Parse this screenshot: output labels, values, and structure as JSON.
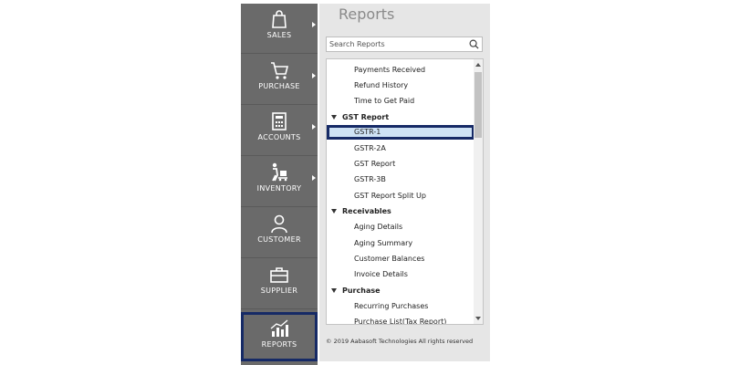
{
  "sidebar": {
    "items": [
      {
        "label": "SALES",
        "icon": "shopping-bag-icon",
        "has_arrow": true
      },
      {
        "label": "PURCHASE",
        "icon": "cart-icon",
        "has_arrow": true
      },
      {
        "label": "ACCOUNTS",
        "icon": "calculator-icon",
        "has_arrow": true
      },
      {
        "label": "INVENTORY",
        "icon": "hand-truck-icon",
        "has_arrow": true
      },
      {
        "label": "CUSTOMER",
        "icon": "person-icon",
        "has_arrow": false
      },
      {
        "label": "SUPPLIER",
        "icon": "briefcase-icon",
        "has_arrow": false
      },
      {
        "label": "REPORTS",
        "icon": "bar-chart-icon",
        "has_arrow": false,
        "active": true
      }
    ]
  },
  "panel": {
    "title": "Reports",
    "search_placeholder": "Search Reports",
    "footer": "© 2019 Aabasoft Technologies All rights reserved"
  },
  "tree": [
    {
      "type": "leaf",
      "label": "Payments Received"
    },
    {
      "type": "leaf",
      "label": "Refund History"
    },
    {
      "type": "leaf",
      "label": "Time to Get Paid"
    },
    {
      "type": "group",
      "label": "GST Report"
    },
    {
      "type": "leaf",
      "label": "GSTR-1",
      "selected": true
    },
    {
      "type": "leaf",
      "label": "GSTR-2A"
    },
    {
      "type": "leaf",
      "label": "GST Report"
    },
    {
      "type": "leaf",
      "label": "GSTR-3B"
    },
    {
      "type": "leaf",
      "label": "GST Report Split Up"
    },
    {
      "type": "group",
      "label": "Receivables"
    },
    {
      "type": "leaf",
      "label": "Aging Details"
    },
    {
      "type": "leaf",
      "label": "Aging Summary"
    },
    {
      "type": "leaf",
      "label": "Customer Balances"
    },
    {
      "type": "leaf",
      "label": "Invoice Details"
    },
    {
      "type": "group",
      "label": "Purchase"
    },
    {
      "type": "leaf",
      "label": "Recurring Purchases"
    },
    {
      "type": "leaf",
      "label": "Purchase List(Tax Report)"
    }
  ],
  "colors": {
    "sidebar_bg": "#6a6a6a",
    "highlight_border": "#162a66",
    "selected_bg": "#cfe3f5"
  }
}
